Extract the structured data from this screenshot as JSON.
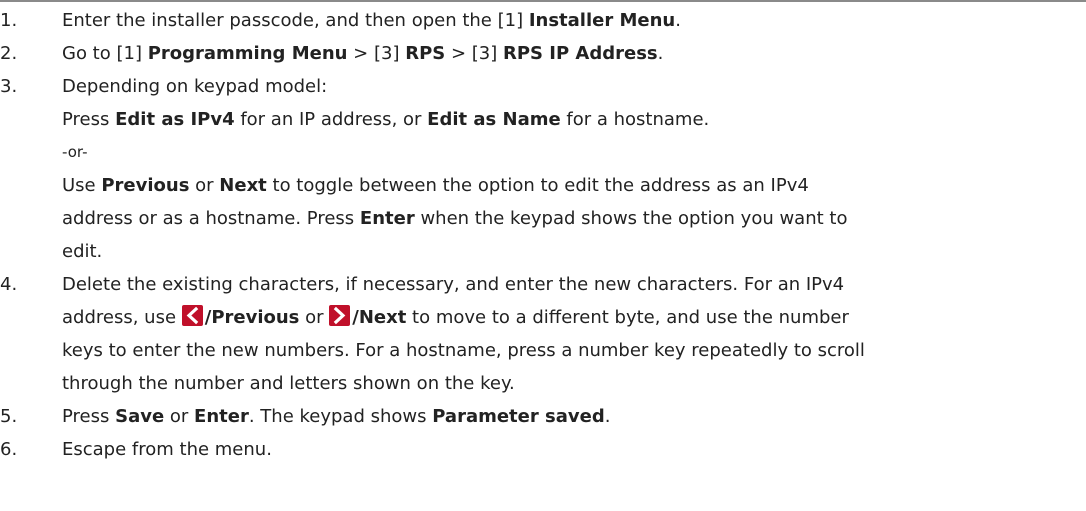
{
  "steps": [
    {
      "number": "1.",
      "parts": [
        "Enter the installer passcode, and then open the [1] ",
        "Installer Menu",
        "."
      ]
    },
    {
      "number": "2.",
      "parts": [
        "Go to [1] ",
        "Programming Menu",
        " > [3] ",
        "RPS",
        " > [3] ",
        "RPS IP Address",
        "."
      ]
    },
    {
      "number": "3.",
      "intro": "Depending on keypad model:",
      "option_a": [
        "Press ",
        "Edit as IPv4",
        " for an IP address, or ",
        "Edit as Name",
        " for a hostname."
      ],
      "or": "-or-",
      "option_b_line1": [
        "Use ",
        "Previous",
        " or ",
        "Next",
        " to toggle between the option to edit the address as an IPv4"
      ],
      "option_b_line2": [
        "address or as a hostname. Press ",
        "Enter",
        " when the keypad shows the option you want to"
      ],
      "option_b_line3": "edit."
    },
    {
      "number": "4.",
      "line1": "Delete the existing characters, if necessary, and enter the new characters. For an IPv4",
      "line2": [
        "address, use ",
        "/Previous",
        " or ",
        "/Next",
        " to move to a different byte, and use the number"
      ],
      "line3": "keys to enter the new numbers. For a hostname, press a number key repeatedly to scroll",
      "line4": "through the number and letters shown on the key.",
      "icons": [
        "left-arrow-key-icon",
        "right-arrow-key-icon"
      ],
      "icon_color": "#c0102a"
    },
    {
      "number": "5.",
      "parts": [
        "Press ",
        "Save",
        " or ",
        "Enter",
        ". The keypad shows ",
        "Parameter saved",
        "."
      ]
    },
    {
      "number": "6.",
      "text": "Escape from the menu."
    }
  ]
}
